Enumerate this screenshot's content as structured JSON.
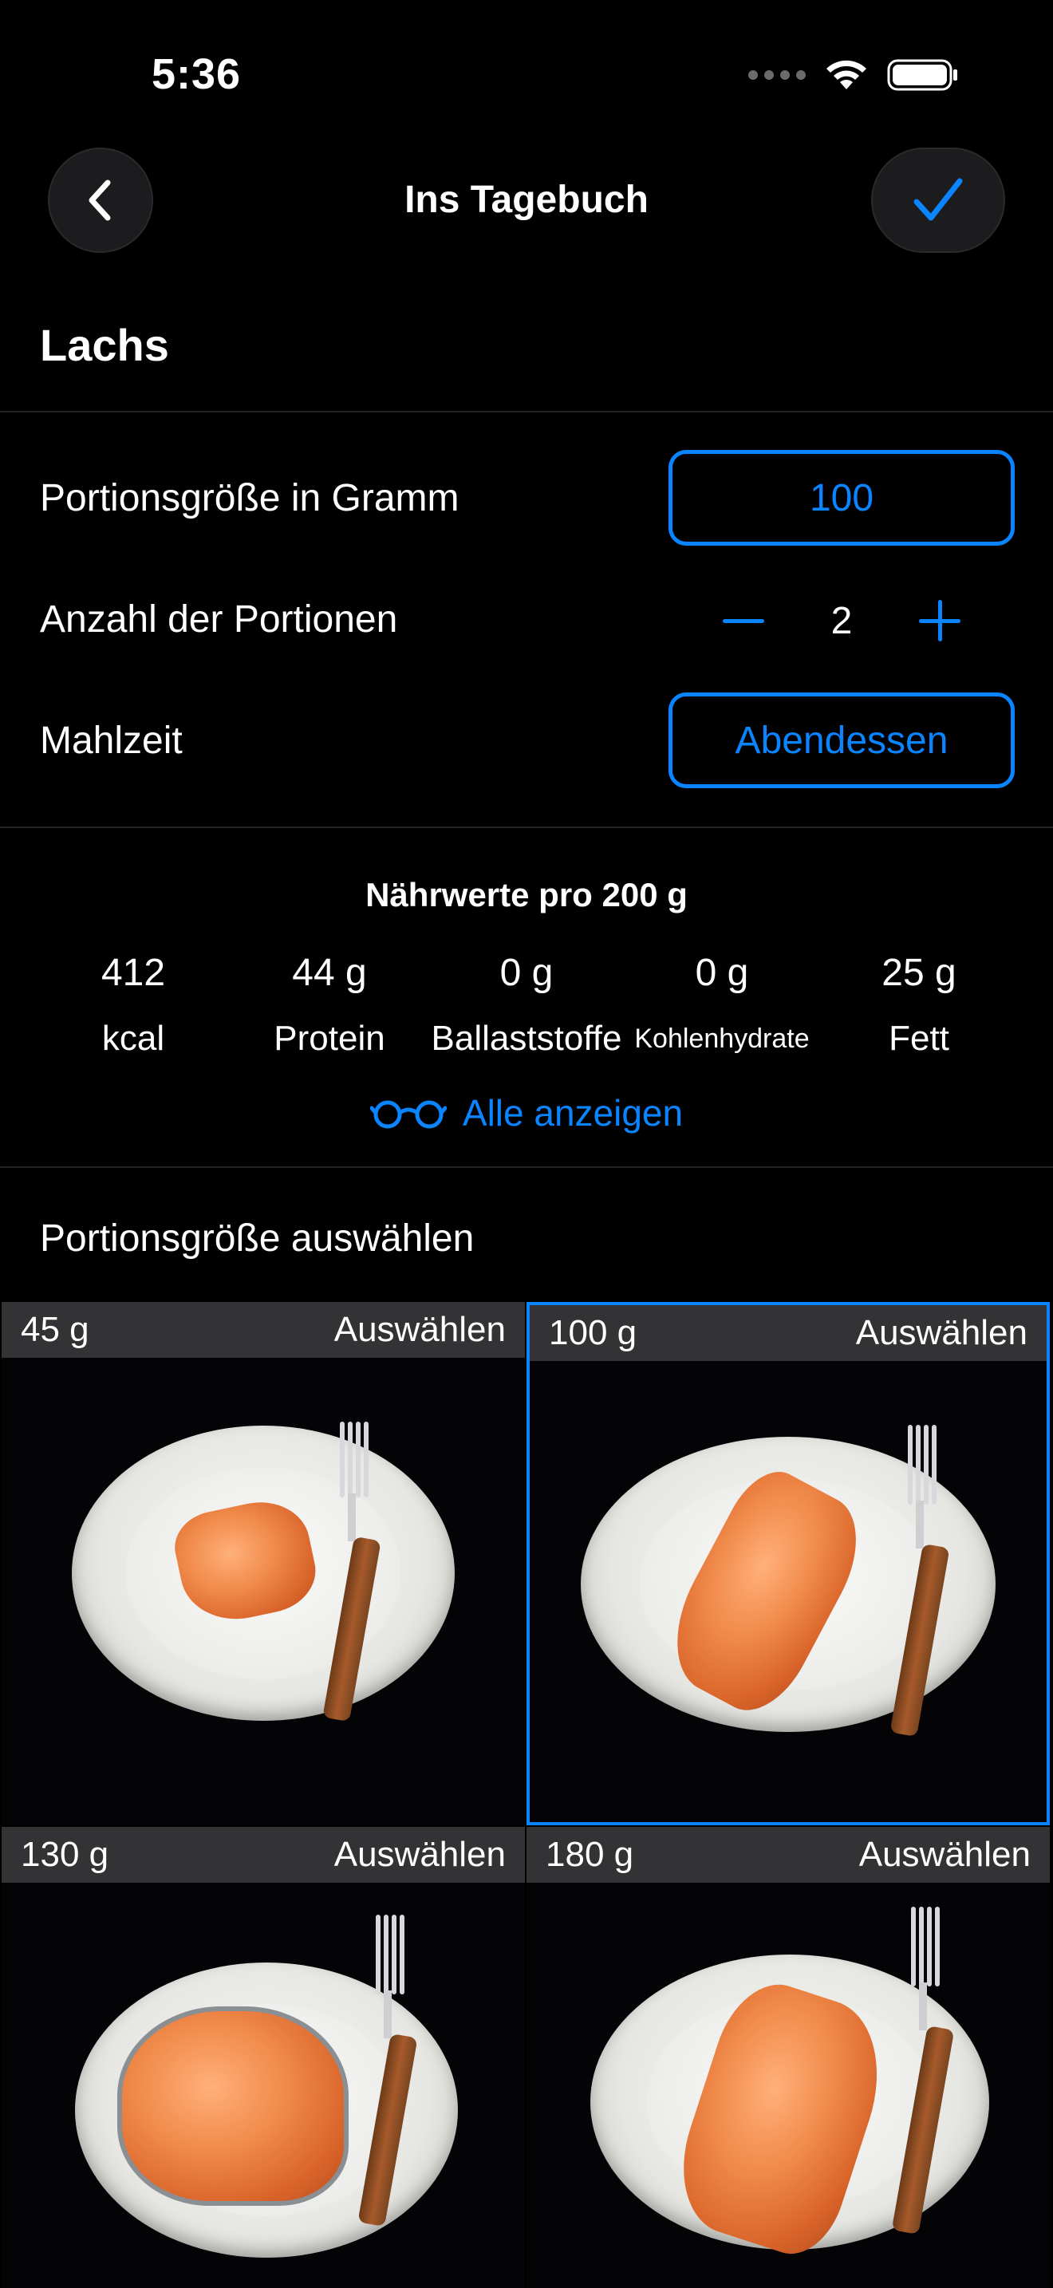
{
  "status_bar": {
    "time": "5:36"
  },
  "nav": {
    "title": "Ins Tagebuch"
  },
  "food": {
    "name": "Lachs"
  },
  "form": {
    "portion_size_label": "Portionsgröße in Gramm",
    "portion_size_value": "100",
    "count_label": "Anzahl der Portionen",
    "count_value": "2",
    "meal_label": "Mahlzeit",
    "meal_value": "Abendessen"
  },
  "nutrition": {
    "heading": "Nährwerte pro 200 g",
    "items": [
      {
        "value": "412",
        "label": "kcal"
      },
      {
        "value": "44 g",
        "label": "Protein"
      },
      {
        "value": "0 g",
        "label": "Ballaststoffe"
      },
      {
        "value": "0 g",
        "label": "Kohlenhydrate"
      },
      {
        "value": "25 g",
        "label": "Fett"
      }
    ],
    "show_all": "Alle anzeigen"
  },
  "portions": {
    "section_title": "Portionsgröße auswählen",
    "select_label": "Auswählen",
    "options": [
      {
        "weight": "45 g",
        "selected": false
      },
      {
        "weight": "100 g",
        "selected": true
      },
      {
        "weight": "130 g",
        "selected": false
      },
      {
        "weight": "180 g",
        "selected": false
      }
    ]
  },
  "colors": {
    "accent": "#0a84ff",
    "background": "#000000",
    "tile_header": "#333335"
  }
}
